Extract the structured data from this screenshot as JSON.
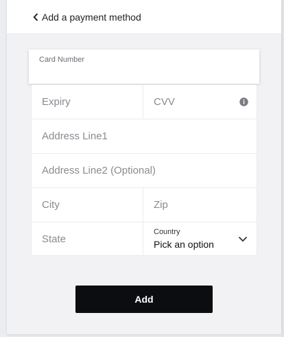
{
  "header": {
    "title": "Add a payment method"
  },
  "form": {
    "card_number_label": "Card Number",
    "card_number_value": "",
    "expiry_placeholder": "Expiry",
    "cvv_placeholder": "CVV",
    "address1_placeholder": "Address Line1",
    "address2_placeholder": "Address Line2 (Optional)",
    "city_placeholder": "City",
    "zip_placeholder": "Zip",
    "state_placeholder": "State",
    "country_label": "Country",
    "country_value": "Pick an option"
  },
  "actions": {
    "add_label": "Add"
  },
  "icons": {
    "back": "chevron-left-icon",
    "cvv_info": "info-icon",
    "country_dropdown": "chevron-down-icon"
  },
  "colors": {
    "button_bg": "#0c0d10",
    "button_text": "#ffffff",
    "page_bg": "#ecedf0"
  }
}
